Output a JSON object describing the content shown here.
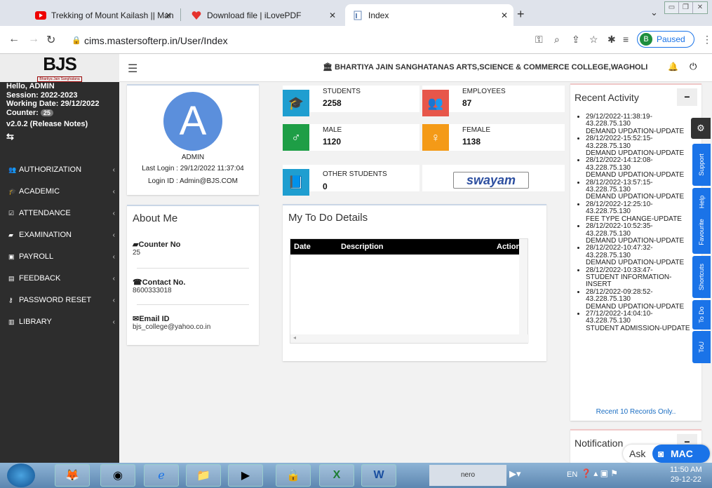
{
  "browser": {
    "tabs": [
      {
        "title": "Trekking of Mount Kailash || Man"
      },
      {
        "title": "Download file | iLovePDF"
      },
      {
        "title": "Index"
      }
    ],
    "url": "cims.mastersofterp.in/User/Index",
    "profile_initial": "B",
    "profile_status": "Paused"
  },
  "header": {
    "logo_text": "BJS",
    "logo_sub": "Bhartiya Jain Sanghatana",
    "college": "BHARTIYA JAIN SANGHATANAS ARTS,SCIENCE & COMMERCE COLLEGE,WAGHOLI"
  },
  "user": {
    "hello": "Hello, ADMIN",
    "session": "Session: 2022-2023",
    "working_date": "Working Date: 29/12/2022",
    "counter_label": "Counter:",
    "counter_value": "25",
    "version": "v2.0.2 (Release Notes)"
  },
  "menu": [
    {
      "label": "AUTHORIZATION",
      "icon": "users-icon"
    },
    {
      "label": "ACADEMIC",
      "icon": "graduation-cap-icon"
    },
    {
      "label": "ATTENDANCE",
      "icon": "check-square-icon"
    },
    {
      "label": "EXAMINATION",
      "icon": "book-icon"
    },
    {
      "label": "PAYROLL",
      "icon": "money-icon"
    },
    {
      "label": "FEEDBACK",
      "icon": "list-icon"
    },
    {
      "label": "PASSWORD RESET",
      "icon": "key-icon"
    },
    {
      "label": "LIBRARY",
      "icon": "book-square-icon"
    }
  ],
  "profile": {
    "initial": "A",
    "name": "ADMIN",
    "last_login": "Last Login : 29/12/2022 11:37:04",
    "login_id": "Login ID : Admin@BJS.COM"
  },
  "stats": {
    "students_label": "STUDENTS",
    "students": "2258",
    "employees_label": "EMPLOYEES",
    "employees": "87",
    "male_label": "MALE",
    "male": "1120",
    "female_label": "FEMALE",
    "female": "1138",
    "other_label": "OTHER STUDENTS",
    "other": "0",
    "swayam": "swayam"
  },
  "about": {
    "title": "About Me",
    "counter_label": "Counter No",
    "counter_value": "25",
    "contact_label": "Contact No.",
    "contact_value": "8600333018",
    "email_label": "Email ID",
    "email_value": "bjs_college@yahoo.co.in"
  },
  "todo": {
    "title": "My To Do Details",
    "col_date": "Date",
    "col_desc": "Description",
    "col_action": "Action"
  },
  "recent": {
    "title": "Recent Activity",
    "items": [
      [
        "29/12/2022-11:38:19-",
        "43.228.75.130",
        "DEMAND UPDATION-UPDATE"
      ],
      [
        "28/12/2022-15:52:15-",
        "43.228.75.130",
        "DEMAND UPDATION-UPDATE"
      ],
      [
        "28/12/2022-14:12:08-",
        "43.228.75.130",
        "DEMAND UPDATION-UPDATE"
      ],
      [
        "28/12/2022-13:57:15-",
        "43.228.75.130",
        "DEMAND UPDATION-UPDATE"
      ],
      [
        "28/12/2022-12:25:10-",
        "43.228.75.130",
        "FEE TYPE CHANGE-UPDATE"
      ],
      [
        "28/12/2022-10:52:35-",
        "43.228.75.130",
        "DEMAND UPDATION-UPDATE"
      ],
      [
        "28/12/2022-10:47:32-",
        "43.228.75.130",
        "DEMAND UPDATION-UPDATE"
      ],
      [
        "28/12/2022-10:33:47-",
        "STUDENT INFORMATION-",
        "INSERT"
      ],
      [
        "28/12/2022-09:28:52-",
        "43.228.75.130",
        "DEMAND UPDATION-UPDATE"
      ],
      [
        "27/12/2022-14:04:10-",
        "43.228.75.130",
        "STUDENT ADMISSION-UPDATE"
      ]
    ],
    "footer": "Recent 10 Records Only..",
    "notification": "Notification"
  },
  "side_tabs": [
    "Support",
    "Help",
    "Favourite",
    "Shortcuts",
    "To Do",
    "ToU"
  ],
  "chat": {
    "ask": "Ask",
    "brand": "MAC"
  },
  "taskbar": {
    "lang": "EN",
    "time": "11:50 AM",
    "date": "29-12-22",
    "nero": "nero"
  }
}
